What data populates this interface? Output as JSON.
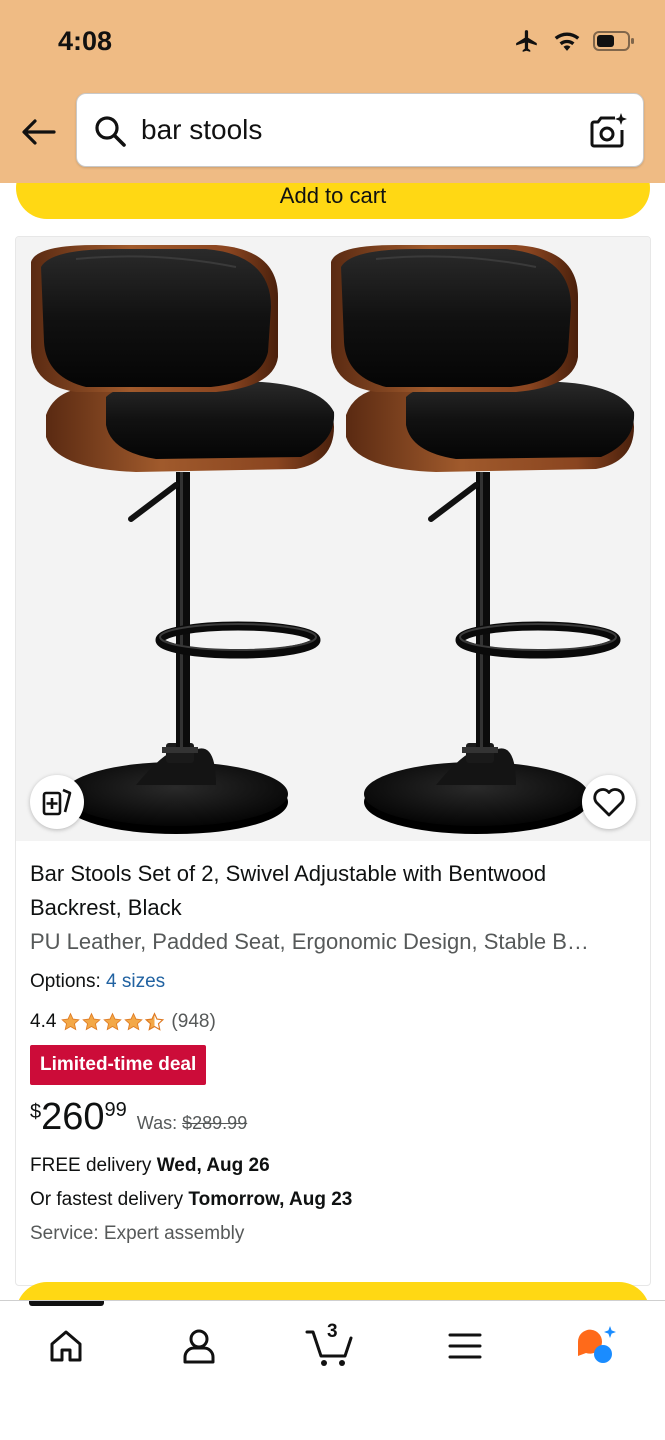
{
  "status_bar": {
    "time": "4:08"
  },
  "search": {
    "query": "bar stools"
  },
  "top_button": {
    "label": "Add to cart"
  },
  "product": {
    "title": "Bar Stools Set of 2, Swivel Adjustable with Bentwood Backrest, Black",
    "subtitle": "PU Leather, Padded Seat, Ergonomic Design, Stable B…",
    "options_label": "Options:",
    "options_value": "4 sizes",
    "rating": "4.4",
    "rating_stars": 4.4,
    "rating_count": "(948)",
    "deal_badge": "Limited-time deal",
    "price_symbol": "$",
    "price_whole": "260",
    "price_fraction": "99",
    "was_label": "Was:",
    "was_price": "$289.99",
    "delivery_prefix": "FREE delivery ",
    "delivery_date": "Wed, Aug 26",
    "fastest_prefix": "Or fastest delivery ",
    "fastest_date": "Tomorrow, Aug 23",
    "service": "Service: Expert assembly"
  },
  "bottom_nav": {
    "items": [
      "home-icon",
      "account-icon",
      "cart-icon",
      "menu-icon",
      "rufus-icon"
    ],
    "cart_count": "3"
  },
  "colors": {
    "header_bg": "#efbb84",
    "button_yellow": "#ffd814",
    "deal_red": "#cc0c39",
    "star_orange": "#f3a847",
    "link_blue": "#2162a1"
  }
}
